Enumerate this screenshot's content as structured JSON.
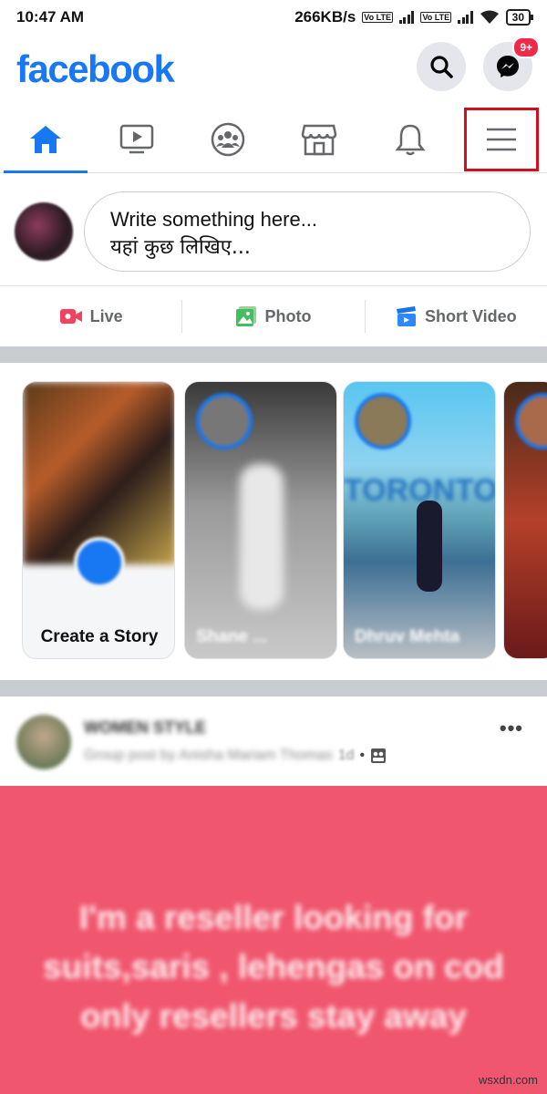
{
  "status_bar": {
    "time": "10:47 AM",
    "net_speed": "266KB/s",
    "battery": "30"
  },
  "header": {
    "logo": "facebook",
    "messenger_badge": "9+"
  },
  "nav": {
    "tabs": [
      {
        "name": "home",
        "icon": "home-icon",
        "active": true
      },
      {
        "name": "watch",
        "icon": "video-icon",
        "active": false
      },
      {
        "name": "groups",
        "icon": "groups-icon",
        "active": false
      },
      {
        "name": "marketplace",
        "icon": "store-icon",
        "active": false
      },
      {
        "name": "notifications",
        "icon": "bell-icon",
        "active": false
      },
      {
        "name": "menu",
        "icon": "hamburger-icon",
        "active": false,
        "highlighted": true
      }
    ]
  },
  "composer": {
    "line1": "Write something here...",
    "line2": "यहां कुछ लिखिए..."
  },
  "actions": {
    "live": "Live",
    "photo": "Photo",
    "short_video": "Short Video"
  },
  "stories": {
    "create_label": "Create a Story",
    "items": [
      "Shane ...",
      "Dhruv Mehta"
    ]
  },
  "post": {
    "author": "WOMEN STYLE",
    "meta": "Group post by Anisha Mariam Thomas",
    "time": "1d",
    "text": "I'm a reseller looking for suits,saris , lehengas on cod only resellers stay away"
  },
  "watermark": "wsxdn.com",
  "colors": {
    "brand": "#1877f2",
    "highlight": "#d0111d",
    "post_bg": "#f0566e"
  }
}
